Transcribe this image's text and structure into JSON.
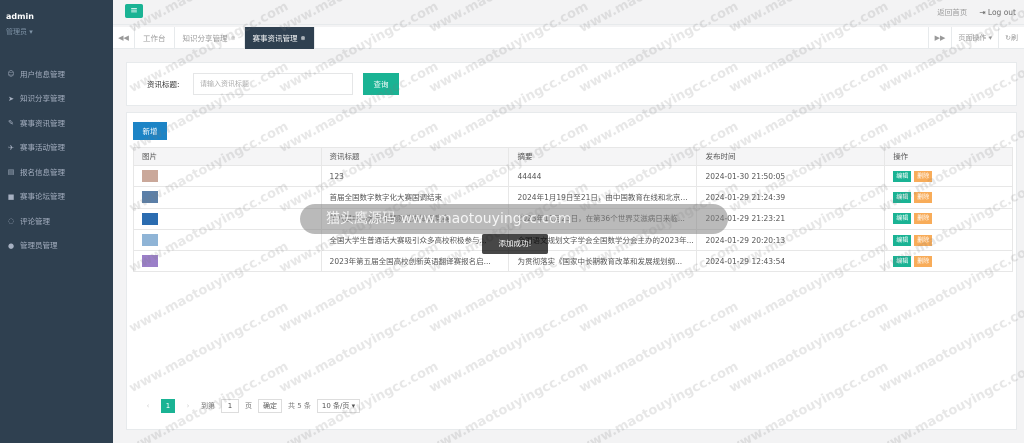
{
  "user": {
    "name": "admin",
    "role": "管理员 ▾"
  },
  "sidebar": {
    "items": [
      {
        "label": "用户信息管理",
        "icon": "person-icon"
      },
      {
        "label": "知识分享管理",
        "icon": "paper-plane-icon"
      },
      {
        "label": "赛事资讯管理",
        "icon": "wrench-icon"
      },
      {
        "label": "赛事活动管理",
        "icon": "rocket-icon"
      },
      {
        "label": "报名信息管理",
        "icon": "id-card-icon"
      },
      {
        "label": "赛事论坛管理",
        "icon": "book-icon"
      },
      {
        "label": "评论管理",
        "icon": "comment-icon"
      },
      {
        "label": "管理员管理",
        "icon": "user-circle-icon"
      }
    ]
  },
  "header": {
    "home_link": "返回首页",
    "logout": "Log out"
  },
  "tabs": {
    "items": [
      {
        "label": "工作台",
        "closable": false
      },
      {
        "label": "知识分享管理",
        "closable": true
      },
      {
        "label": "赛事资讯管理",
        "closable": true,
        "active": true
      }
    ],
    "page_ops": "页面操作 ▾",
    "refresh": "刷"
  },
  "search": {
    "label": "资讯标题:",
    "placeholder": "请输入资讯标题",
    "button": "查询"
  },
  "table": {
    "add_button": "新增",
    "columns": [
      "图片",
      "资讯标题",
      "摘要",
      "发布时间",
      "操作"
    ],
    "rows": [
      {
        "title": "123",
        "summary": "44444",
        "time": "2024-01-30 21:50:05",
        "thumb": "#caa89a"
      },
      {
        "title": "首届全国数字数字化大赛国调结束",
        "summary": "2024年1月19日至21日，由中国教育在线和北京...",
        "time": "2024-01-29 21:24:39",
        "thumb": "#5b7fa8"
      },
      {
        "title": "第八届中国大学生预防艾滋知识竞赛",
        "summary": "2023年11月23日，在第36个世界艾滋病日来临...",
        "time": "2024-01-29 21:23:21",
        "thumb": "#2b6cb0"
      },
      {
        "title": "全国大学生普通话大赛吸引众多高校积极参与...",
        "summary": "全国语文规划文字学会全国数学分会主办的2023年...",
        "time": "2024-01-29 20:20:13",
        "thumb": "#8fb4d6"
      },
      {
        "title": "2023年第五届全国高校创新英语翻译赛报名启...",
        "summary": "为贯彻落实《国家中长期教育改革和发展规划纲...",
        "time": "2024-01-29 12:43:54",
        "thumb": "#9b7fc8"
      }
    ],
    "op_edit": "编辑",
    "op_delete": "删除"
  },
  "pager": {
    "current": "1",
    "goto_label": "到第",
    "goto_value": "1",
    "page_unit": "页",
    "confirm": "确定",
    "total": "共 5 条",
    "page_size": "10 条/页 ▾"
  },
  "toast": "添加成功!",
  "banner": "猫头鹰源码 www.maotouyingcc.com",
  "watermark": "www.maotouyingcc.com",
  "colors": {
    "sidebar": "#2f4050",
    "primary": "#1ab394",
    "blue": "#1c84c6",
    "orange": "#f8ac59"
  }
}
